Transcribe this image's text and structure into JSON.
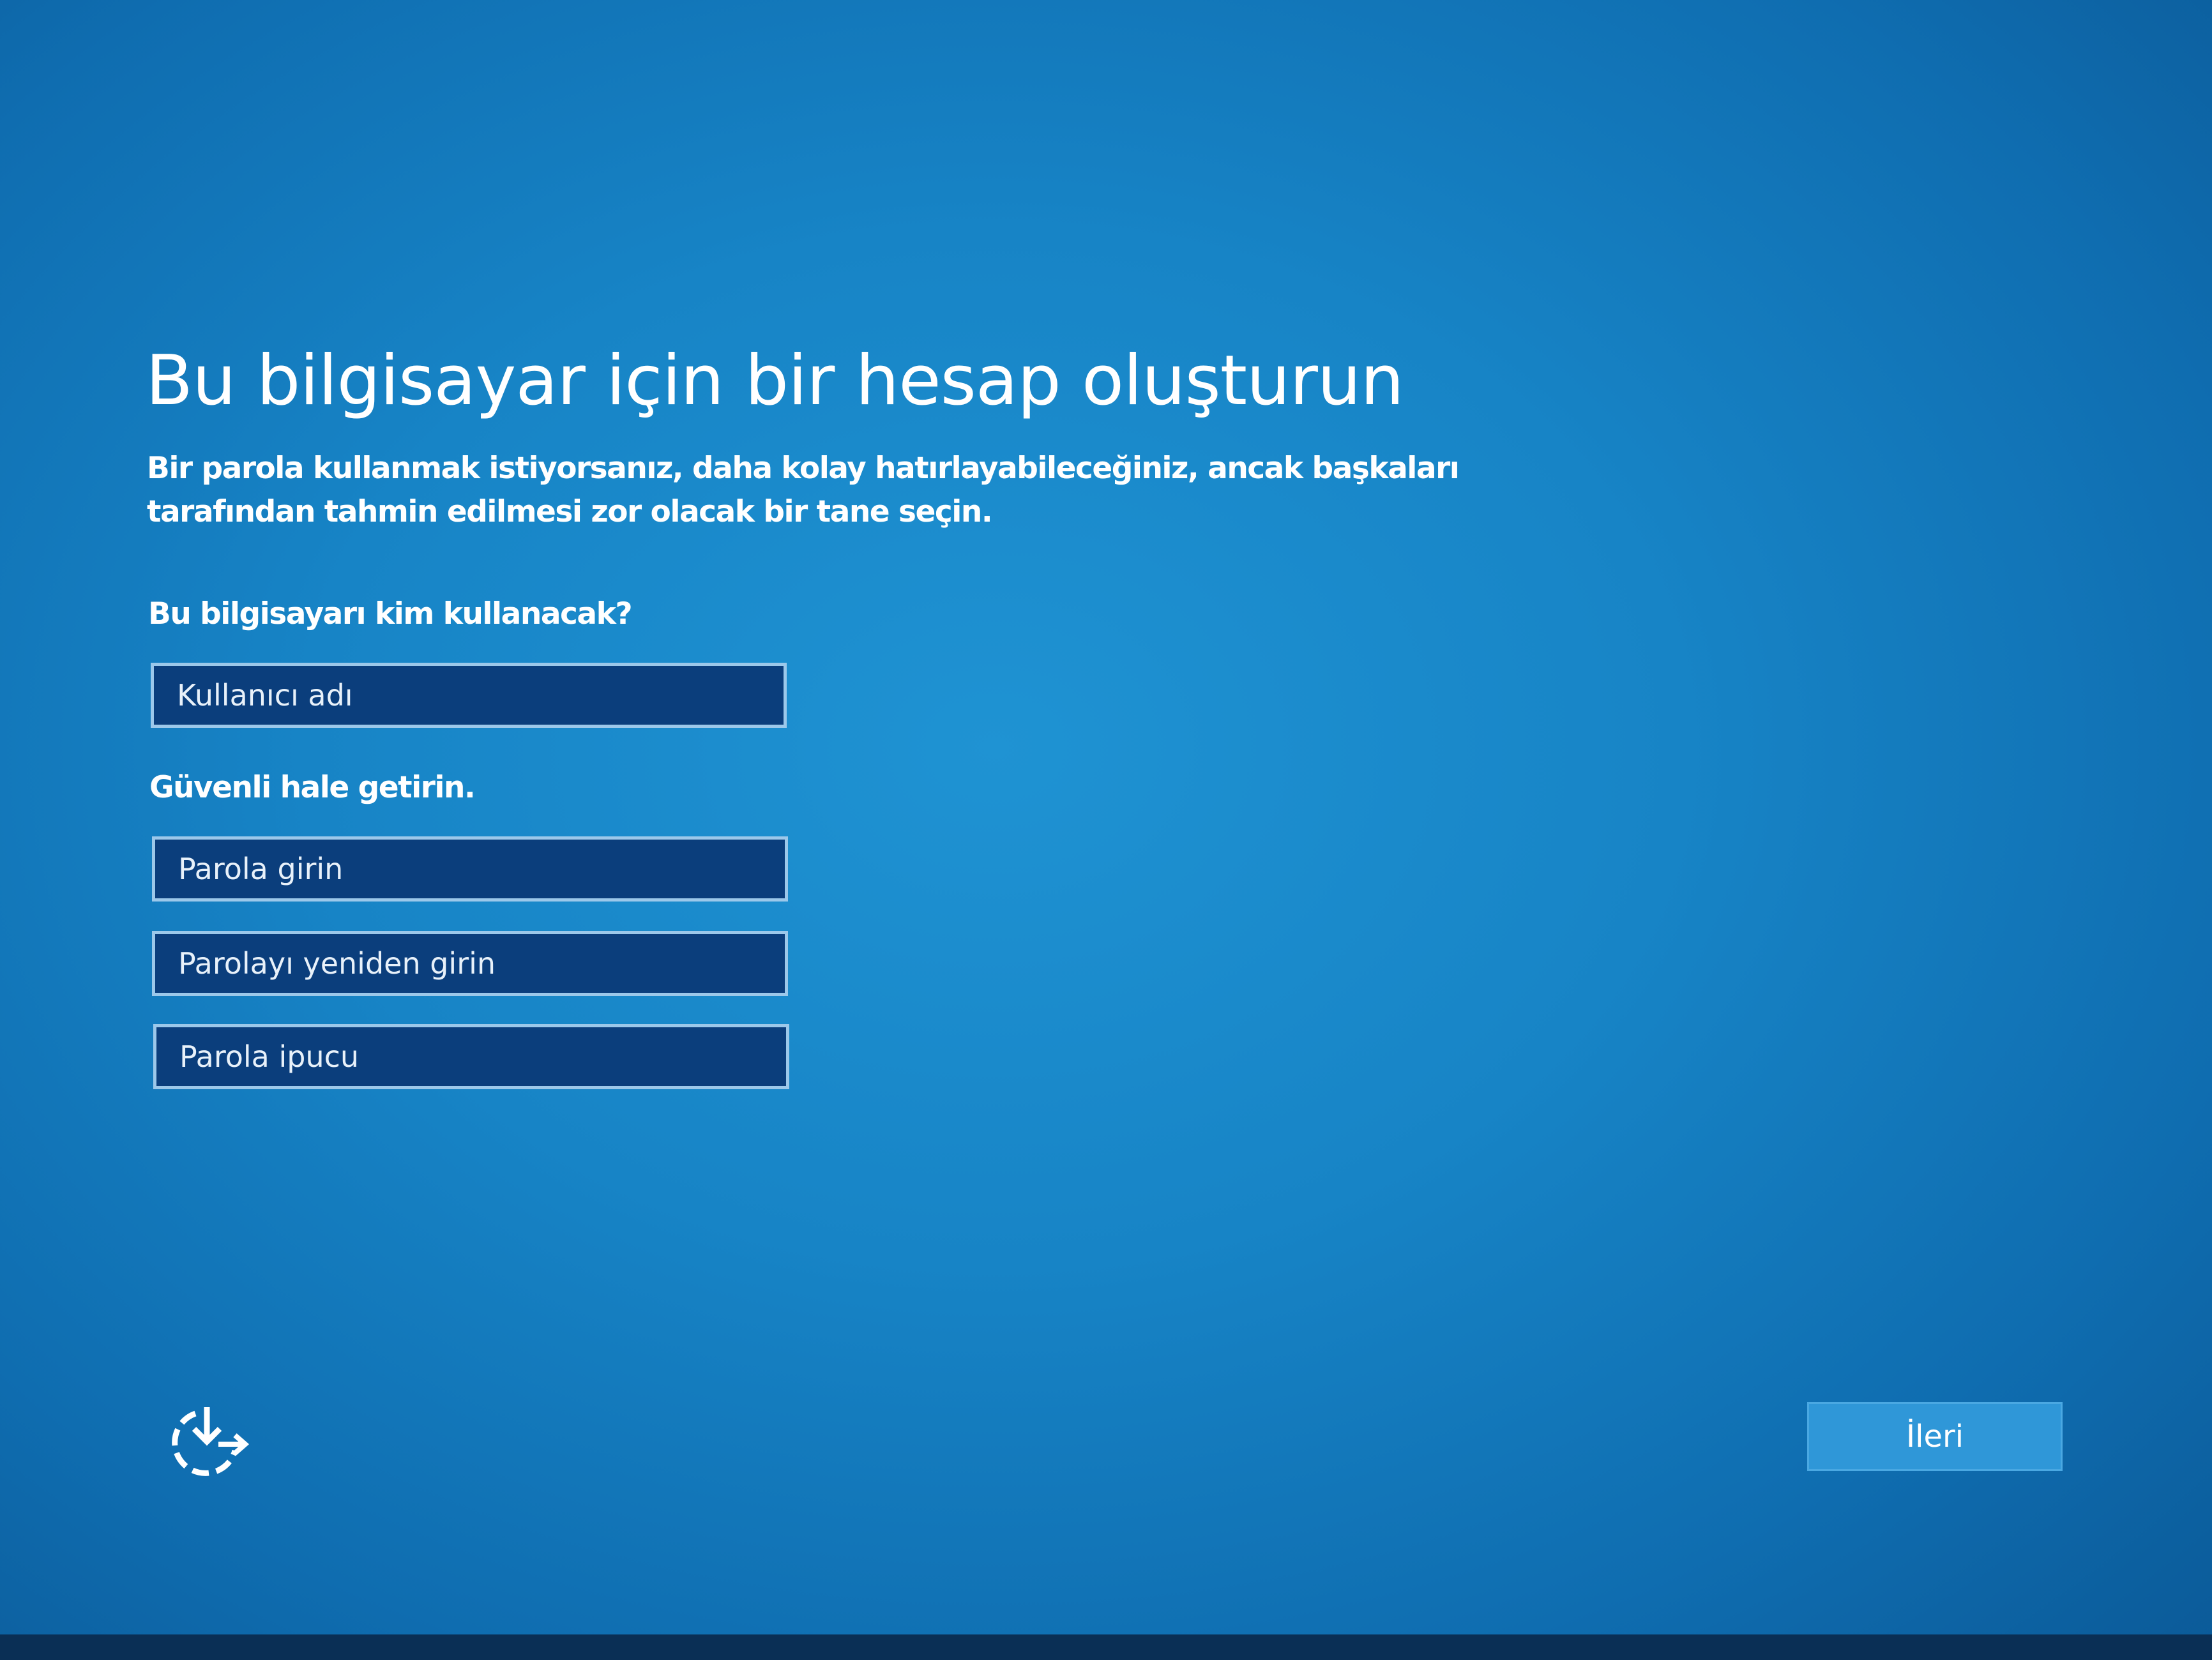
{
  "page": {
    "title": "Bu bilgisayar için bir hesap oluşturun",
    "description": "Bir parola kullanmak istiyorsanız, daha kolay hatırlayabileceğiniz, ancak başkaları tarafından tahmin edilmesi zor olacak bir tane seçin."
  },
  "user_section": {
    "label": "Bu bilgisayarı kim kullanacak?",
    "username_field": {
      "value": "",
      "placeholder": "Kullanıcı adı"
    }
  },
  "security_section": {
    "label": "Güvenli hale getirin.",
    "password_field": {
      "value": "",
      "placeholder": "Parola girin"
    },
    "reenter_password_field": {
      "value": "",
      "placeholder": "Parolayı yeniden girin"
    },
    "password_hint_field": {
      "value": "",
      "placeholder": "Parola ipucu"
    }
  },
  "footer": {
    "accessibility_icon": "ease-of-access-icon",
    "next_label": "İleri"
  },
  "colors": {
    "background": "#1784c6",
    "field_background": "#0b3e7c",
    "field_border": "#9cc8ea",
    "button_background": "#2f97d8"
  }
}
